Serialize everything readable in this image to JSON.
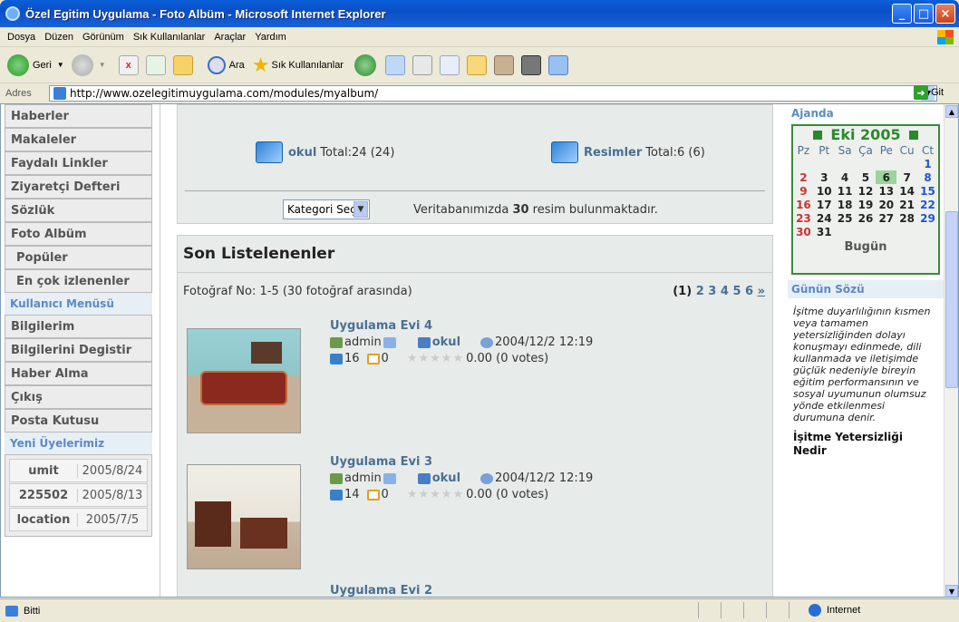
{
  "window": {
    "title": "Özel Egitim Uygulama - Foto Albüm - Microsoft Internet Explorer"
  },
  "menu": [
    "Dosya",
    "Düzen",
    "Görünüm",
    "Sık Kullanılanlar",
    "Araçlar",
    "Yardım"
  ],
  "toolbar": {
    "back_label": "Geri",
    "search_label": "Ara",
    "favorites_label": "Sık Kullanılanlar"
  },
  "address": {
    "label": "Adres",
    "url": "http://www.ozelegitimuygulama.com/modules/myalbum/",
    "go_label": "Git"
  },
  "left_menu": {
    "items": [
      "Haberler",
      "Makaleler",
      "Faydalı Linkler",
      "Ziyaretçi Defteri",
      "Sözlük",
      "Foto Albüm"
    ],
    "sub_items": [
      "Popüler",
      "En çok izlenenler"
    ],
    "user_menu_title": "Kullanıcı Menüsü",
    "user_items": [
      "Bilgilerim",
      "Bilgilerini Degistir",
      "Haber Alma",
      "Çıkış",
      "Posta Kutusu"
    ],
    "members_title": "Yeni Üyelerimiz",
    "members": [
      {
        "name": "umit",
        "date": "2005/8/24"
      },
      {
        "name": "225502",
        "date": "2005/8/13"
      },
      {
        "name": "location",
        "date": "2005/7/5"
      }
    ]
  },
  "categories": [
    {
      "name": "okul",
      "total": "Total:24 (24)"
    },
    {
      "name": "Resimler",
      "total": "Total:6 (6)"
    }
  ],
  "category_select": "Kategori Seçin",
  "db_text_pre": "Veritabanımızda",
  "db_count": "30",
  "db_text_post": "resim bulunmaktadır.",
  "listing": {
    "title": "Son Listelenenler",
    "count_text": "Fotoğraf No: 1-5 (30 fotoğraf arasında)",
    "pager": {
      "current": "(1)",
      "pages": [
        "2",
        "3",
        "4",
        "5",
        "6"
      ],
      "next": "»"
    },
    "photos": [
      {
        "title": "Uygulama Evi 4",
        "author": "admin",
        "category": "okul",
        "date": "2004/12/2 12:19",
        "views": "16",
        "comments": "0",
        "rating": "0.00 (0 votes)"
      },
      {
        "title": "Uygulama Evi 3",
        "author": "admin",
        "category": "okul",
        "date": "2004/12/2 12:19",
        "views": "14",
        "comments": "0",
        "rating": "0.00 (0 votes)"
      },
      {
        "title": "Uygulama Evi 2"
      }
    ]
  },
  "agenda": {
    "title": "Ajanda",
    "month": "Eki 2005",
    "weekdays": [
      "Pz",
      "Pt",
      "Sa",
      "Ça",
      "Pe",
      "Cu",
      "Ct"
    ],
    "today_label": "Bugün"
  },
  "quote": {
    "title": "Günün Sözü",
    "text": "İşitme duyarlılığının kısmen veya tamamen yetersizliğinden dolayı konuşmayı edinmede, dili kullanmada ve iletişimde güçlük nedeniyle bireyin eğitim performansının ve sosyal uyumunun olumsuz yönde etkilenmesi durumuna denir.",
    "link": "İşitme Yetersizliği Nedir"
  },
  "status": {
    "text": "Bitti",
    "zone": "Internet"
  }
}
